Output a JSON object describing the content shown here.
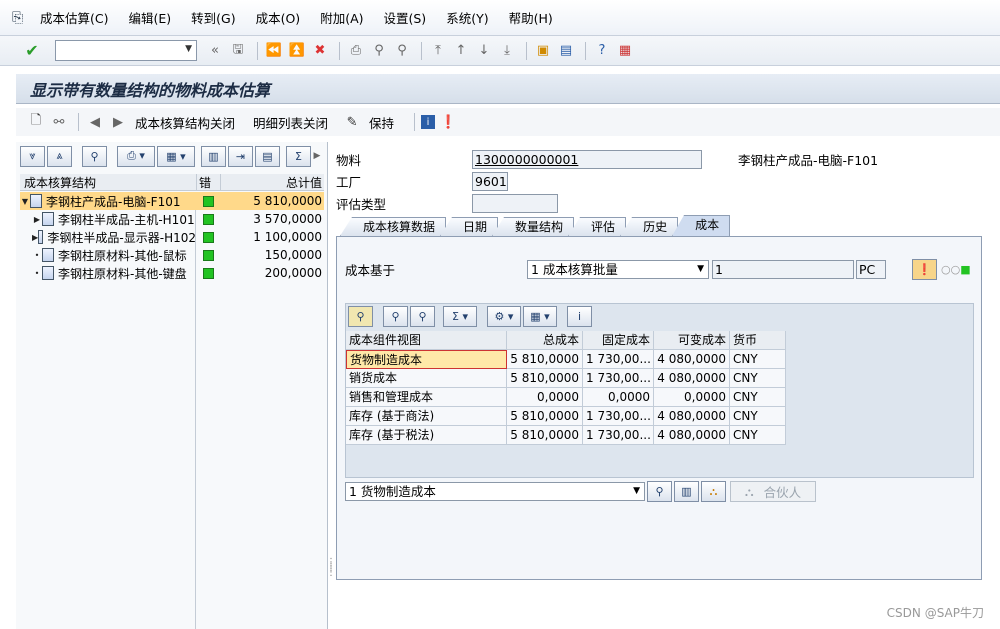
{
  "menubar": {
    "items": [
      "成本估算(C)",
      "编辑(E)",
      "转到(G)",
      "成本(O)",
      "附加(A)",
      "设置(S)",
      "系统(Y)",
      "帮助(H)"
    ]
  },
  "toolbar": {
    "command_value": ""
  },
  "title": "显示带有数量结构的物料成本估算",
  "app_toolbar": {
    "btn_structure_close": "成本核算结构关闭",
    "btn_detail_close": "明细列表关闭",
    "btn_keep": "保持"
  },
  "tree": {
    "headers": [
      "成本核算结构",
      "错",
      "总计值"
    ],
    "rows": [
      {
        "label": "李钢柱产成品-电脑-F101",
        "value": "5 810,0000",
        "tri": "▼"
      },
      {
        "label": "李钢柱半成品-主机-H101",
        "value": "3 570,0000",
        "tri": "▶"
      },
      {
        "label": "李钢柱半成品-显示器-H102",
        "value": "1 100,0000",
        "tri": "▶"
      },
      {
        "label": "李钢柱原材料-其他-鼠标",
        "value": "150,0000",
        "tri": "•"
      },
      {
        "label": "李钢柱原材料-其他-键盘",
        "value": "200,0000",
        "tri": "•"
      }
    ]
  },
  "header_fields": {
    "material_label": "物料",
    "material_value": "1300000000001",
    "material_desc": "李钢柱产成品-电脑-F101",
    "plant_label": "工厂",
    "plant_value": "9601",
    "valuation_label": "评估类型",
    "valuation_value": ""
  },
  "tabs": [
    "成本核算数据",
    "日期",
    "数量结构",
    "评估",
    "历史",
    "成本"
  ],
  "cost_based": {
    "label": "成本基于",
    "select_value": "1 成本核算批量",
    "qty_value": "1",
    "unit": "PC"
  },
  "grid": {
    "headers": [
      "成本组件视图",
      "总成本",
      "固定成本",
      "可变成本",
      "货币"
    ],
    "rows": [
      [
        "货物制造成本",
        "5 810,0000",
        "1 730,00...",
        "4 080,0000",
        "CNY"
      ],
      [
        "销货成本",
        "5 810,0000",
        "1 730,00...",
        "4 080,0000",
        "CNY"
      ],
      [
        "销售和管理成本",
        "0,0000",
        "0,0000",
        "0,0000",
        "CNY"
      ],
      [
        "库存 (基于商法)",
        "5 810,0000",
        "1 730,00...",
        "4 080,0000",
        "CNY"
      ],
      [
        "库存 (基于税法)",
        "5 810,0000",
        "1 730,00...",
        "4 080,0000",
        "CNY"
      ]
    ]
  },
  "bottom": {
    "select_value": "1 货物制造成本",
    "partner_label": "合伙人"
  },
  "watermark": "CSDN @SAP牛刀",
  "colors": {
    "status_ok": "#22c322",
    "selection": "#ffd98a"
  }
}
